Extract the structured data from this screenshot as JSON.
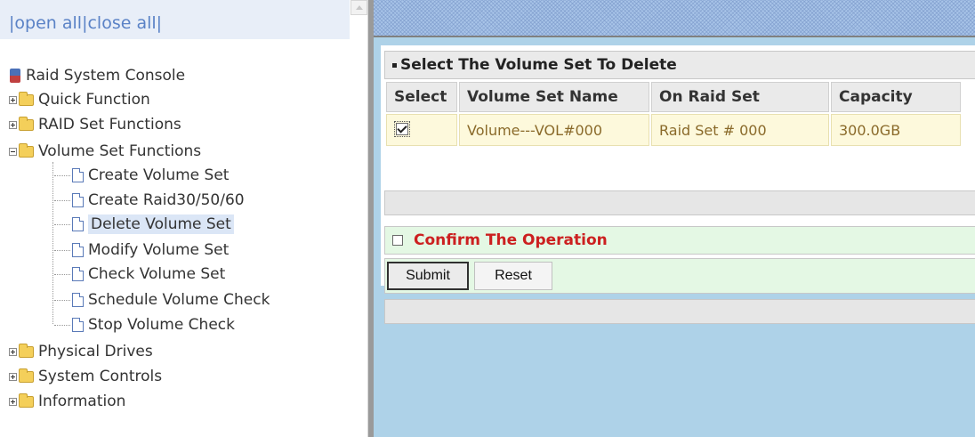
{
  "nav": {
    "open_all": "open all",
    "close_all": "close all",
    "sep": "|"
  },
  "tree": {
    "root": "Raid System Console",
    "items": [
      {
        "label": "Quick Function",
        "icon": "folder-icon",
        "expanded": false
      },
      {
        "label": "RAID Set Functions",
        "icon": "folder-icon",
        "expanded": false
      },
      {
        "label": "Volume Set Functions",
        "icon": "folder-open-icon",
        "expanded": true,
        "children": [
          "Create Volume Set",
          "Create Raid30/50/60",
          "Delete Volume Set",
          "Modify Volume Set",
          "Check Volume Set",
          "Schedule Volume Check",
          "Stop Volume Check"
        ],
        "selected": "Delete Volume Set"
      },
      {
        "label": "Physical Drives",
        "icon": "folder-icon",
        "expanded": false
      },
      {
        "label": "System Controls",
        "icon": "folder-icon",
        "expanded": false
      },
      {
        "label": "Information",
        "icon": "folder-icon",
        "expanded": false
      }
    ]
  },
  "content": {
    "section_title": "Select The Volume Set To Delete",
    "columns": [
      "Select",
      "Volume Set Name",
      "On Raid Set",
      "Capacity"
    ],
    "rows": [
      {
        "selected": true,
        "name": "Volume---VOL#000",
        "raid_set": "Raid Set # 000",
        "capacity": "300.0GB"
      }
    ],
    "confirm_label": "Confirm The Operation",
    "confirm_checked": false,
    "submit_label": "Submit",
    "reset_label": "Reset"
  },
  "colors": {
    "link": "#5a82c6",
    "confirm_text": "#cc2020",
    "table_cell_bg": "#fdf9dc",
    "content_bg": "#aed2e8"
  }
}
